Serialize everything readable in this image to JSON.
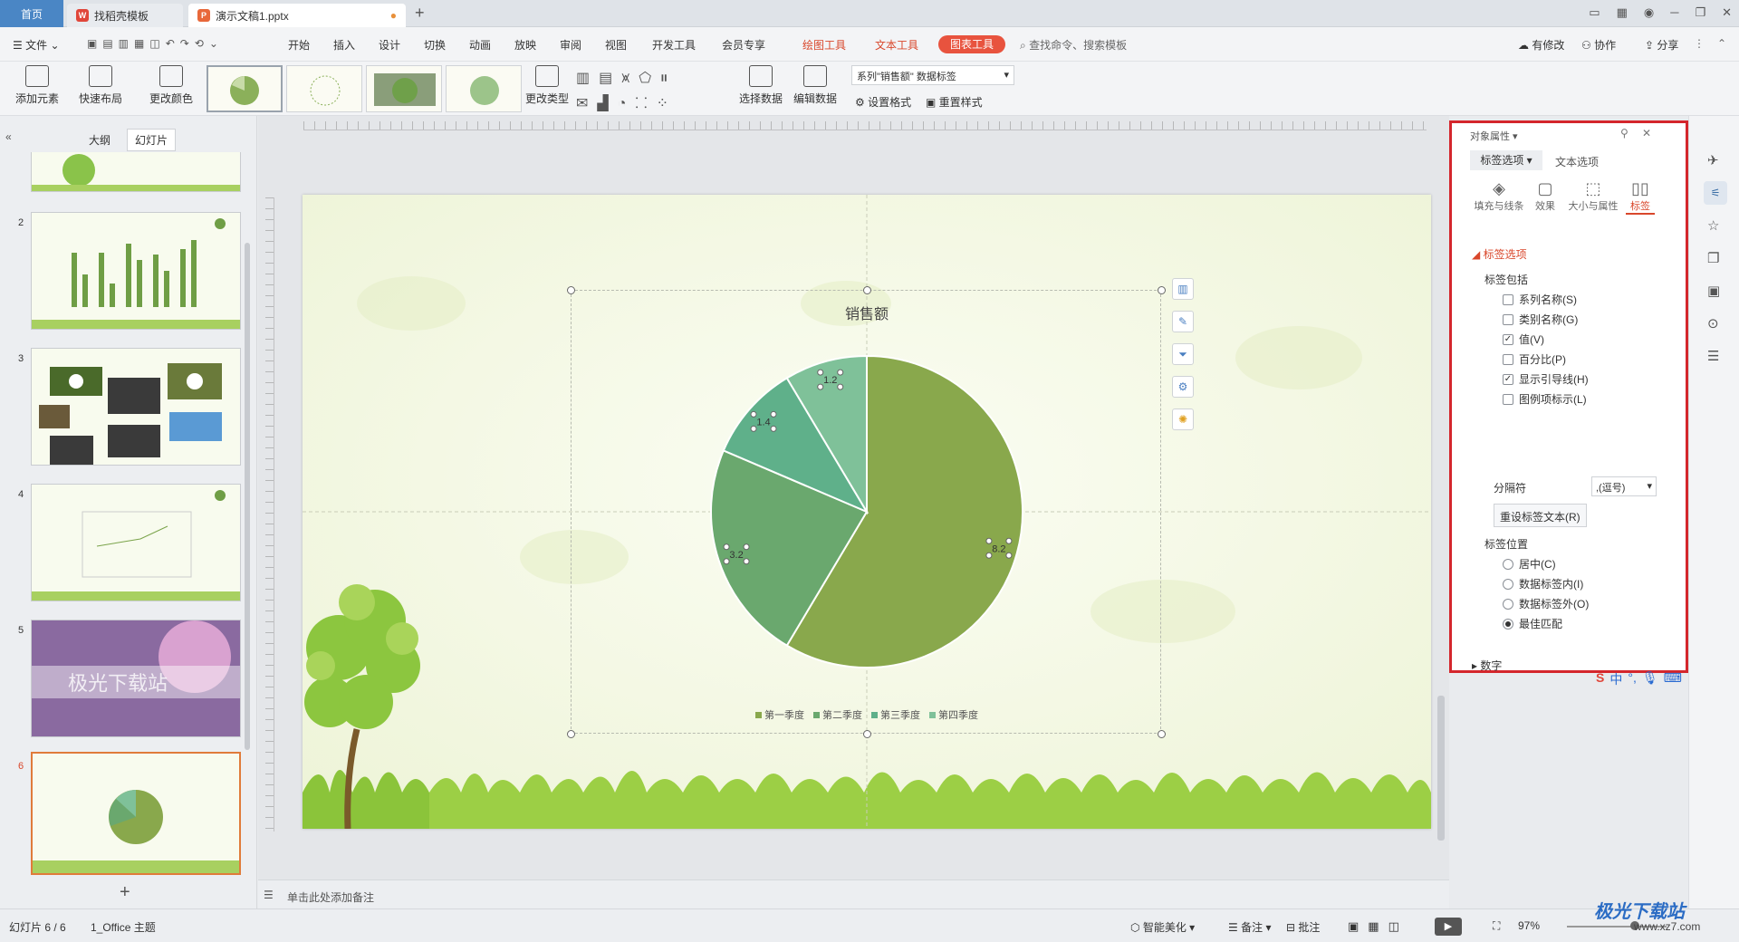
{
  "tabs": {
    "home": "首页",
    "templates": "找稻壳模板",
    "doc": "演示文稿1.pptx",
    "new": "+"
  },
  "menu": {
    "file": "文件",
    "items": [
      "开始",
      "插入",
      "设计",
      "切换",
      "动画",
      "放映",
      "审阅",
      "视图",
      "开发工具",
      "会员专享"
    ],
    "drawing_tools": "绘图工具",
    "text_tools": "文本工具",
    "chart_tools": "图表工具",
    "search": "查找命令、搜索模板",
    "modified": "有修改",
    "collab": "协作",
    "share": "分享"
  },
  "ribbon": {
    "add_element": "添加元素",
    "quick_layout": "快速布局",
    "change_color": "更改颜色",
    "change_type": "更改类型",
    "select_data": "选择数据",
    "edit_data": "编辑数据",
    "series_select": "系列\"销售额\" 数据标签",
    "set_format": "设置格式",
    "reset_style": "重置样式"
  },
  "left": {
    "outline": "大纲",
    "slides": "幻灯片",
    "numbers": [
      "2",
      "3",
      "4",
      "5",
      "6"
    ],
    "slide5_text": "极光下载站",
    "add": "+"
  },
  "slide": {
    "chart_title": "销售额"
  },
  "chart_data": {
    "type": "pie",
    "title": "销售额",
    "categories": [
      "第一季度",
      "第二季度",
      "第三季度",
      "第四季度"
    ],
    "values": [
      8.2,
      3.2,
      1.4,
      1.2
    ],
    "labels": [
      "8.2",
      "3.2",
      "1.4",
      "1.2"
    ],
    "colors": [
      "#89a84c",
      "#6aa86e",
      "#5fb08a",
      "#7fc199"
    ],
    "legend": "bottom"
  },
  "notes": {
    "placeholder": "单击此处添加备注"
  },
  "panel": {
    "title": "对象属性",
    "tab_label": "标签选项",
    "tab_text": "文本选项",
    "sub_fill": "填充与线条",
    "sub_effect": "效果",
    "sub_size": "大小与属性",
    "sub_label": "标签",
    "section": "标签选项",
    "includes": "标签包括",
    "checks": [
      {
        "label": "系列名称(S)",
        "checked": false
      },
      {
        "label": "类别名称(G)",
        "checked": false
      },
      {
        "label": "值(V)",
        "checked": true
      },
      {
        "label": "百分比(P)",
        "checked": false
      },
      {
        "label": "显示引导线(H)",
        "checked": true
      },
      {
        "label": "图例项标示(L)",
        "checked": false
      }
    ],
    "separator_label": "分隔符",
    "separator_value": ",(逗号)",
    "reset_button": "重设标签文本(R)",
    "position_label": "标签位置",
    "positions": [
      {
        "label": "居中(C)",
        "selected": false
      },
      {
        "label": "数据标签内(I)",
        "selected": false
      },
      {
        "label": "数据标签外(O)",
        "selected": false
      },
      {
        "label": "最佳匹配",
        "selected": true
      }
    ],
    "number": "数字"
  },
  "status": {
    "slide_count": "幻灯片 6 / 6",
    "theme": "1_Office 主题",
    "beautify": "智能美化",
    "notes": "备注",
    "comments": "批注",
    "zoom": "97%"
  },
  "watermark": "极光下载站",
  "watermark_url": "www.xz7.com"
}
